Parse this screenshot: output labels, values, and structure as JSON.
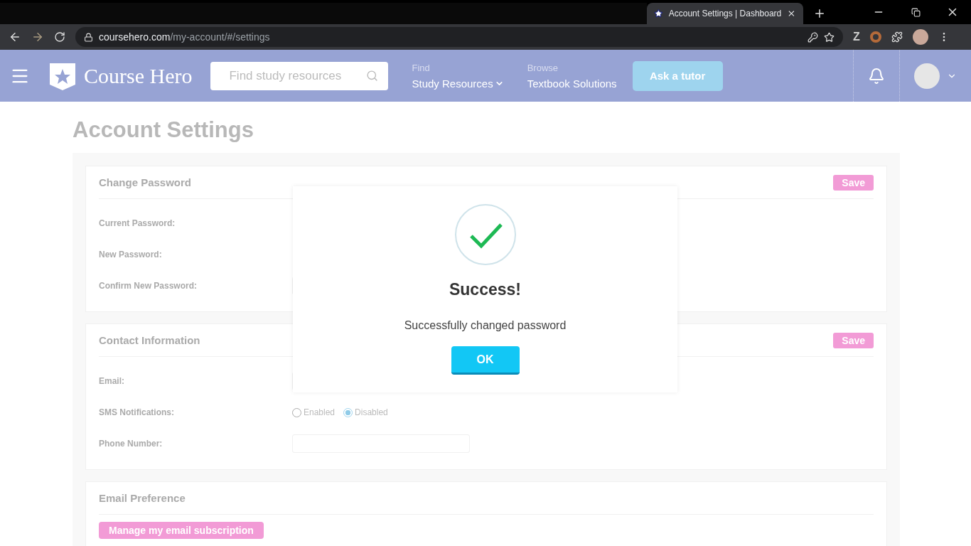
{
  "browser": {
    "tab_title": "Account Settings | Dashboard",
    "url_host": "coursehero.com",
    "url_path": "/my-account/#/settings",
    "extension_label": "Z"
  },
  "nav": {
    "logo": "Course Hero",
    "search": {
      "placeholder": "Find study resources"
    },
    "links": [
      {
        "caption": "Find",
        "label": "Study Resources",
        "dropdown": true
      },
      {
        "caption": "Browse",
        "label": "Textbook Solutions",
        "dropdown": false
      }
    ],
    "ask_button": "Ask a tutor"
  },
  "page_title": "Account Settings",
  "sections": [
    {
      "title": "Change Password",
      "save": "Save",
      "fields": [
        {
          "kind": "text",
          "label": "Current Password:"
        },
        {
          "kind": "text",
          "label": "New Password:"
        },
        {
          "kind": "text",
          "label": "Confirm New Password:"
        }
      ]
    },
    {
      "title": "Contact Information",
      "save": "Save",
      "fields": [
        {
          "kind": "text",
          "label": "Email:"
        },
        {
          "kind": "radio",
          "label": "SMS Notifications:",
          "options": [
            {
              "label": "Enabled",
              "selected": false
            },
            {
              "label": "Disabled",
              "selected": true
            }
          ]
        },
        {
          "kind": "text",
          "label": "Phone Number:"
        }
      ]
    },
    {
      "title": "Email Preference",
      "action": "Manage my email subscription"
    }
  ],
  "modal": {
    "title": "Success!",
    "message": "Successfully changed password",
    "button": "OK"
  }
}
